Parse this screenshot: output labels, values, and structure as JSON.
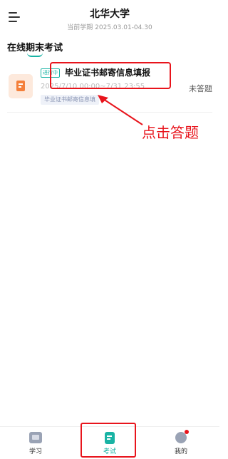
{
  "header": {
    "title": "北华大学",
    "semester_label": "当前学期 2025.03.01-04.30"
  },
  "section": {
    "title": "在线期末考试"
  },
  "exam": {
    "status_badge": "进行中",
    "title": "毕业证书邮寄信息填报",
    "time_range": "2025/7/10 00:00~7/31 23:55",
    "tag": "毕业证书邮寄信息填",
    "answer_status": "未答题",
    "icon": "document-icon"
  },
  "annotation": {
    "text": "点击答题",
    "color": "#e8141c"
  },
  "tabbar": {
    "items": [
      {
        "label": "学习",
        "icon": "tv-icon",
        "active": false
      },
      {
        "label": "考试",
        "icon": "exam-paper-icon",
        "active": true
      },
      {
        "label": "我的",
        "icon": "profile-icon",
        "active": false,
        "badge_dot": true
      }
    ]
  },
  "colors": {
    "accent": "#19b3a4",
    "annotation_red": "#e8141c",
    "icon_orange": "#f47f3a"
  }
}
